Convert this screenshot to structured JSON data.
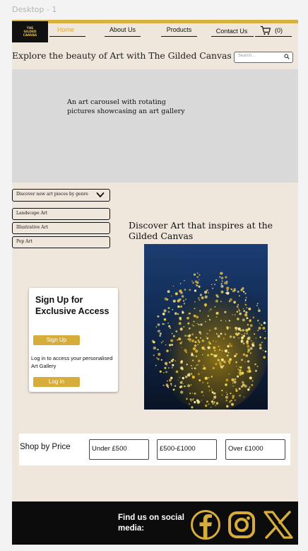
{
  "frame": {
    "label": "Desktop - 1"
  },
  "brand": {
    "logo_lines": [
      "THE",
      "GILDED",
      "CANVAS"
    ]
  },
  "nav": {
    "home": "Home",
    "about": "About Us",
    "products": "Products",
    "contact": "Contact Us",
    "cart_count": "(0)"
  },
  "header": {
    "headline": "Explore the beauty of Art with The Gilded Canvas",
    "search_placeholder": "Search..."
  },
  "carousel": {
    "text": "An art carousel with rotating pictures showcasing an art gallery"
  },
  "genres": {
    "dropdown_label": "Discover new art pieces by genre",
    "items": [
      "Landscape Art",
      "Illustrative Art",
      "Pop Art"
    ]
  },
  "featured": {
    "title": "Discover Art that inspires at the Gilded Canvas"
  },
  "signup": {
    "title": "Sign Up for Exclusive Access",
    "signup_button": "Sign Up",
    "login_text": "Log in to access your personalised Art Gallery",
    "login_button": "Log In"
  },
  "shop": {
    "title": "Shop by Price",
    "options": [
      "Under £500",
      "£500-£1000",
      "Over £1000"
    ]
  },
  "footer": {
    "social_text": "Find us on social media:"
  },
  "colors": {
    "accent_gold": "#d6ad3a",
    "page_bg": "#efe6dc",
    "footer_bg": "#0c0c0c"
  }
}
